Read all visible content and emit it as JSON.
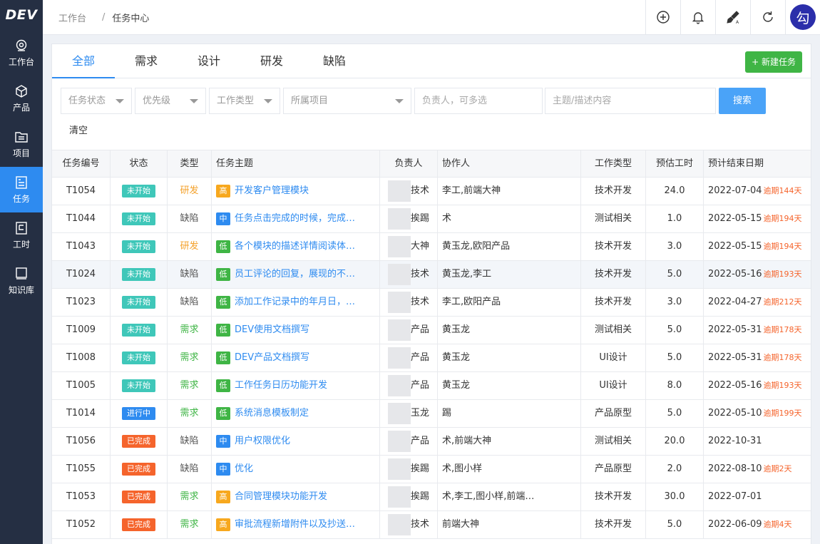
{
  "app": {
    "logo": "DEV"
  },
  "sidebar": {
    "items": [
      {
        "label": "工作台",
        "icon": "dashboard-icon"
      },
      {
        "label": "产品",
        "icon": "cube-icon"
      },
      {
        "label": "项目",
        "icon": "folder-icon"
      },
      {
        "label": "任务",
        "icon": "task-list-icon",
        "active": true
      },
      {
        "label": "工时",
        "icon": "timesheet-icon"
      },
      {
        "label": "知识库",
        "icon": "book-icon"
      }
    ]
  },
  "header": {
    "breadcrumb": {
      "home": "工作台",
      "separator": "/",
      "current": "任务中心"
    },
    "icons": [
      "add-circle-icon",
      "bell-icon",
      "theme-brush-icon",
      "refresh-icon"
    ],
    "avatar_text": "勾"
  },
  "tabs": [
    {
      "label": "全部",
      "active": true
    },
    {
      "label": "需求"
    },
    {
      "label": "设计"
    },
    {
      "label": "研发"
    },
    {
      "label": "缺陷"
    }
  ],
  "new_task_label": "+ 新建任务",
  "filters": {
    "status": "任务状态",
    "priority": "优先级",
    "work_type": "工作类型",
    "project": "所属项目",
    "assignee_placeholder": "负责人，可多选",
    "subject_placeholder": "主题/描述内容",
    "search_label": "搜索",
    "clear_label": "清空"
  },
  "table": {
    "columns": [
      "任务编号",
      "状态",
      "类型",
      "任务主题",
      "负责人",
      "协作人",
      "工作类型",
      "预估工时",
      "预计结束日期"
    ],
    "rows": [
      {
        "id": "T1054",
        "status": "未开始",
        "status_kind": "todo",
        "type": "研发",
        "type_kind": "dev",
        "priority": "高",
        "priority_kind": "high",
        "subject": "开发客户管理模块",
        "assignee": "技术",
        "collaborators": "李工,前端大神",
        "work_type": "技术开发",
        "hours": "24.0",
        "end_date": "2022-07-04",
        "overdue": "逾期144天"
      },
      {
        "id": "T1044",
        "status": "未开始",
        "status_kind": "todo",
        "type": "缺陷",
        "type_kind": "bug",
        "priority": "中",
        "priority_kind": "mid",
        "subject": "任务点击完成的时候，完成…",
        "assignee": "挨踢",
        "collaborators": "术",
        "work_type": "测试相关",
        "hours": "1.0",
        "end_date": "2022-05-15",
        "overdue": "逾期194天"
      },
      {
        "id": "T1043",
        "status": "未开始",
        "status_kind": "todo",
        "type": "研发",
        "type_kind": "dev",
        "priority": "低",
        "priority_kind": "low",
        "subject": "各个模块的描述详情阅读体…",
        "assignee": "大神",
        "collaborators": "黄玉龙,欧阳产品",
        "work_type": "技术开发",
        "hours": "3.0",
        "end_date": "2022-05-15",
        "overdue": "逾期194天"
      },
      {
        "id": "T1024",
        "status": "未开始",
        "status_kind": "todo",
        "type": "缺陷",
        "type_kind": "bug",
        "priority": "低",
        "priority_kind": "low",
        "subject": "员工评论的回复，展现的不…",
        "assignee": "技术",
        "collaborators": "黄玉龙,李工",
        "work_type": "技术开发",
        "hours": "5.0",
        "end_date": "2022-05-16",
        "overdue": "逾期193天"
      },
      {
        "id": "T1023",
        "status": "未开始",
        "status_kind": "todo",
        "type": "缺陷",
        "type_kind": "bug",
        "priority": "低",
        "priority_kind": "low",
        "subject": "添加工作记录中的年月日，…",
        "assignee": "技术",
        "collaborators": "李工,欧阳产品",
        "work_type": "技术开发",
        "hours": "3.0",
        "end_date": "2022-04-27",
        "overdue": "逾期212天"
      },
      {
        "id": "T1009",
        "status": "未开始",
        "status_kind": "todo",
        "type": "需求",
        "type_kind": "req",
        "priority": "低",
        "priority_kind": "low",
        "subject": "DEV使用文档撰写",
        "assignee": "产品",
        "collaborators": "黄玉龙",
        "work_type": "测试相关",
        "hours": "5.0",
        "end_date": "2022-05-31",
        "overdue": "逾期178天"
      },
      {
        "id": "T1008",
        "status": "未开始",
        "status_kind": "todo",
        "type": "需求",
        "type_kind": "req",
        "priority": "低",
        "priority_kind": "low",
        "subject": "DEV产品文档撰写",
        "assignee": "产品",
        "collaborators": "黄玉龙",
        "work_type": "UI设计",
        "hours": "5.0",
        "end_date": "2022-05-31",
        "overdue": "逾期178天"
      },
      {
        "id": "T1005",
        "status": "未开始",
        "status_kind": "todo",
        "type": "需求",
        "type_kind": "req",
        "priority": "低",
        "priority_kind": "low",
        "subject": "工作任务日历功能开发",
        "assignee": "产品",
        "collaborators": "黄玉龙",
        "work_type": "UI设计",
        "hours": "8.0",
        "end_date": "2022-05-16",
        "overdue": "逾期193天"
      },
      {
        "id": "T1014",
        "status": "进行中",
        "status_kind": "doing",
        "type": "需求",
        "type_kind": "req",
        "priority": "低",
        "priority_kind": "low",
        "subject": "系统消息模板制定",
        "assignee": "玉龙",
        "collaborators": "踢",
        "work_type": "产品原型",
        "hours": "5.0",
        "end_date": "2022-05-10",
        "overdue": "逾期199天"
      },
      {
        "id": "T1056",
        "status": "已完成",
        "status_kind": "done",
        "type": "缺陷",
        "type_kind": "bug",
        "priority": "中",
        "priority_kind": "mid",
        "subject": "用户权限优化",
        "assignee": "产品",
        "collaborators": "术,前端大神",
        "work_type": "测试相关",
        "hours": "20.0",
        "end_date": "2022-10-31",
        "overdue": ""
      },
      {
        "id": "T1055",
        "status": "已完成",
        "status_kind": "done",
        "type": "缺陷",
        "type_kind": "bug",
        "priority": "中",
        "priority_kind": "mid",
        "subject": "优化",
        "assignee": "挨踢",
        "collaborators": "术,图小样",
        "work_type": "产品原型",
        "hours": "2.0",
        "end_date": "2022-08-10",
        "overdue": "逾期2天"
      },
      {
        "id": "T1053",
        "status": "已完成",
        "status_kind": "done",
        "type": "需求",
        "type_kind": "req",
        "priority": "高",
        "priority_kind": "high",
        "subject": "合同管理模块功能开发",
        "assignee": "挨踢",
        "collaborators": "术,李工,图小样,前端…",
        "work_type": "技术开发",
        "hours": "30.0",
        "end_date": "2022-07-01",
        "overdue": ""
      },
      {
        "id": "T1052",
        "status": "已完成",
        "status_kind": "done",
        "type": "需求",
        "type_kind": "req",
        "priority": "高",
        "priority_kind": "high",
        "subject": "审批流程新增附件以及抄送…",
        "assignee": "技术",
        "collaborators": "前端大神",
        "work_type": "技术开发",
        "hours": "5.0",
        "end_date": "2022-06-09",
        "overdue": "逾期4天"
      }
    ]
  }
}
